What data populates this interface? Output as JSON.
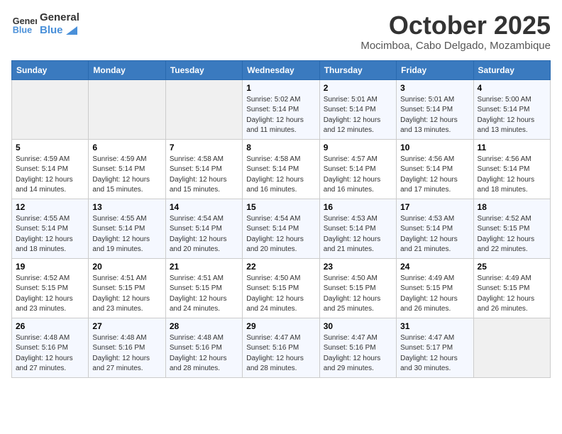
{
  "logo": {
    "line1": "General",
    "line2": "Blue"
  },
  "title": "October 2025",
  "location": "Mocimboa, Cabo Delgado, Mozambique",
  "days_of_week": [
    "Sunday",
    "Monday",
    "Tuesday",
    "Wednesday",
    "Thursday",
    "Friday",
    "Saturday"
  ],
  "weeks": [
    [
      {
        "day": "",
        "sunrise": "",
        "sunset": "",
        "daylight": ""
      },
      {
        "day": "",
        "sunrise": "",
        "sunset": "",
        "daylight": ""
      },
      {
        "day": "",
        "sunrise": "",
        "sunset": "",
        "daylight": ""
      },
      {
        "day": "1",
        "sunrise": "Sunrise: 5:02 AM",
        "sunset": "Sunset: 5:14 PM",
        "daylight": "Daylight: 12 hours and 11 minutes."
      },
      {
        "day": "2",
        "sunrise": "Sunrise: 5:01 AM",
        "sunset": "Sunset: 5:14 PM",
        "daylight": "Daylight: 12 hours and 12 minutes."
      },
      {
        "day": "3",
        "sunrise": "Sunrise: 5:01 AM",
        "sunset": "Sunset: 5:14 PM",
        "daylight": "Daylight: 12 hours and 13 minutes."
      },
      {
        "day": "4",
        "sunrise": "Sunrise: 5:00 AM",
        "sunset": "Sunset: 5:14 PM",
        "daylight": "Daylight: 12 hours and 13 minutes."
      }
    ],
    [
      {
        "day": "5",
        "sunrise": "Sunrise: 4:59 AM",
        "sunset": "Sunset: 5:14 PM",
        "daylight": "Daylight: 12 hours and 14 minutes."
      },
      {
        "day": "6",
        "sunrise": "Sunrise: 4:59 AM",
        "sunset": "Sunset: 5:14 PM",
        "daylight": "Daylight: 12 hours and 15 minutes."
      },
      {
        "day": "7",
        "sunrise": "Sunrise: 4:58 AM",
        "sunset": "Sunset: 5:14 PM",
        "daylight": "Daylight: 12 hours and 15 minutes."
      },
      {
        "day": "8",
        "sunrise": "Sunrise: 4:58 AM",
        "sunset": "Sunset: 5:14 PM",
        "daylight": "Daylight: 12 hours and 16 minutes."
      },
      {
        "day": "9",
        "sunrise": "Sunrise: 4:57 AM",
        "sunset": "Sunset: 5:14 PM",
        "daylight": "Daylight: 12 hours and 16 minutes."
      },
      {
        "day": "10",
        "sunrise": "Sunrise: 4:56 AM",
        "sunset": "Sunset: 5:14 PM",
        "daylight": "Daylight: 12 hours and 17 minutes."
      },
      {
        "day": "11",
        "sunrise": "Sunrise: 4:56 AM",
        "sunset": "Sunset: 5:14 PM",
        "daylight": "Daylight: 12 hours and 18 minutes."
      }
    ],
    [
      {
        "day": "12",
        "sunrise": "Sunrise: 4:55 AM",
        "sunset": "Sunset: 5:14 PM",
        "daylight": "Daylight: 12 hours and 18 minutes."
      },
      {
        "day": "13",
        "sunrise": "Sunrise: 4:55 AM",
        "sunset": "Sunset: 5:14 PM",
        "daylight": "Daylight: 12 hours and 19 minutes."
      },
      {
        "day": "14",
        "sunrise": "Sunrise: 4:54 AM",
        "sunset": "Sunset: 5:14 PM",
        "daylight": "Daylight: 12 hours and 20 minutes."
      },
      {
        "day": "15",
        "sunrise": "Sunrise: 4:54 AM",
        "sunset": "Sunset: 5:14 PM",
        "daylight": "Daylight: 12 hours and 20 minutes."
      },
      {
        "day": "16",
        "sunrise": "Sunrise: 4:53 AM",
        "sunset": "Sunset: 5:14 PM",
        "daylight": "Daylight: 12 hours and 21 minutes."
      },
      {
        "day": "17",
        "sunrise": "Sunrise: 4:53 AM",
        "sunset": "Sunset: 5:14 PM",
        "daylight": "Daylight: 12 hours and 21 minutes."
      },
      {
        "day": "18",
        "sunrise": "Sunrise: 4:52 AM",
        "sunset": "Sunset: 5:15 PM",
        "daylight": "Daylight: 12 hours and 22 minutes."
      }
    ],
    [
      {
        "day": "19",
        "sunrise": "Sunrise: 4:52 AM",
        "sunset": "Sunset: 5:15 PM",
        "daylight": "Daylight: 12 hours and 23 minutes."
      },
      {
        "day": "20",
        "sunrise": "Sunrise: 4:51 AM",
        "sunset": "Sunset: 5:15 PM",
        "daylight": "Daylight: 12 hours and 23 minutes."
      },
      {
        "day": "21",
        "sunrise": "Sunrise: 4:51 AM",
        "sunset": "Sunset: 5:15 PM",
        "daylight": "Daylight: 12 hours and 24 minutes."
      },
      {
        "day": "22",
        "sunrise": "Sunrise: 4:50 AM",
        "sunset": "Sunset: 5:15 PM",
        "daylight": "Daylight: 12 hours and 24 minutes."
      },
      {
        "day": "23",
        "sunrise": "Sunrise: 4:50 AM",
        "sunset": "Sunset: 5:15 PM",
        "daylight": "Daylight: 12 hours and 25 minutes."
      },
      {
        "day": "24",
        "sunrise": "Sunrise: 4:49 AM",
        "sunset": "Sunset: 5:15 PM",
        "daylight": "Daylight: 12 hours and 26 minutes."
      },
      {
        "day": "25",
        "sunrise": "Sunrise: 4:49 AM",
        "sunset": "Sunset: 5:15 PM",
        "daylight": "Daylight: 12 hours and 26 minutes."
      }
    ],
    [
      {
        "day": "26",
        "sunrise": "Sunrise: 4:48 AM",
        "sunset": "Sunset: 5:16 PM",
        "daylight": "Daylight: 12 hours and 27 minutes."
      },
      {
        "day": "27",
        "sunrise": "Sunrise: 4:48 AM",
        "sunset": "Sunset: 5:16 PM",
        "daylight": "Daylight: 12 hours and 27 minutes."
      },
      {
        "day": "28",
        "sunrise": "Sunrise: 4:48 AM",
        "sunset": "Sunset: 5:16 PM",
        "daylight": "Daylight: 12 hours and 28 minutes."
      },
      {
        "day": "29",
        "sunrise": "Sunrise: 4:47 AM",
        "sunset": "Sunset: 5:16 PM",
        "daylight": "Daylight: 12 hours and 28 minutes."
      },
      {
        "day": "30",
        "sunrise": "Sunrise: 4:47 AM",
        "sunset": "Sunset: 5:16 PM",
        "daylight": "Daylight: 12 hours and 29 minutes."
      },
      {
        "day": "31",
        "sunrise": "Sunrise: 4:47 AM",
        "sunset": "Sunset: 5:17 PM",
        "daylight": "Daylight: 12 hours and 30 minutes."
      },
      {
        "day": "",
        "sunrise": "",
        "sunset": "",
        "daylight": ""
      }
    ]
  ]
}
